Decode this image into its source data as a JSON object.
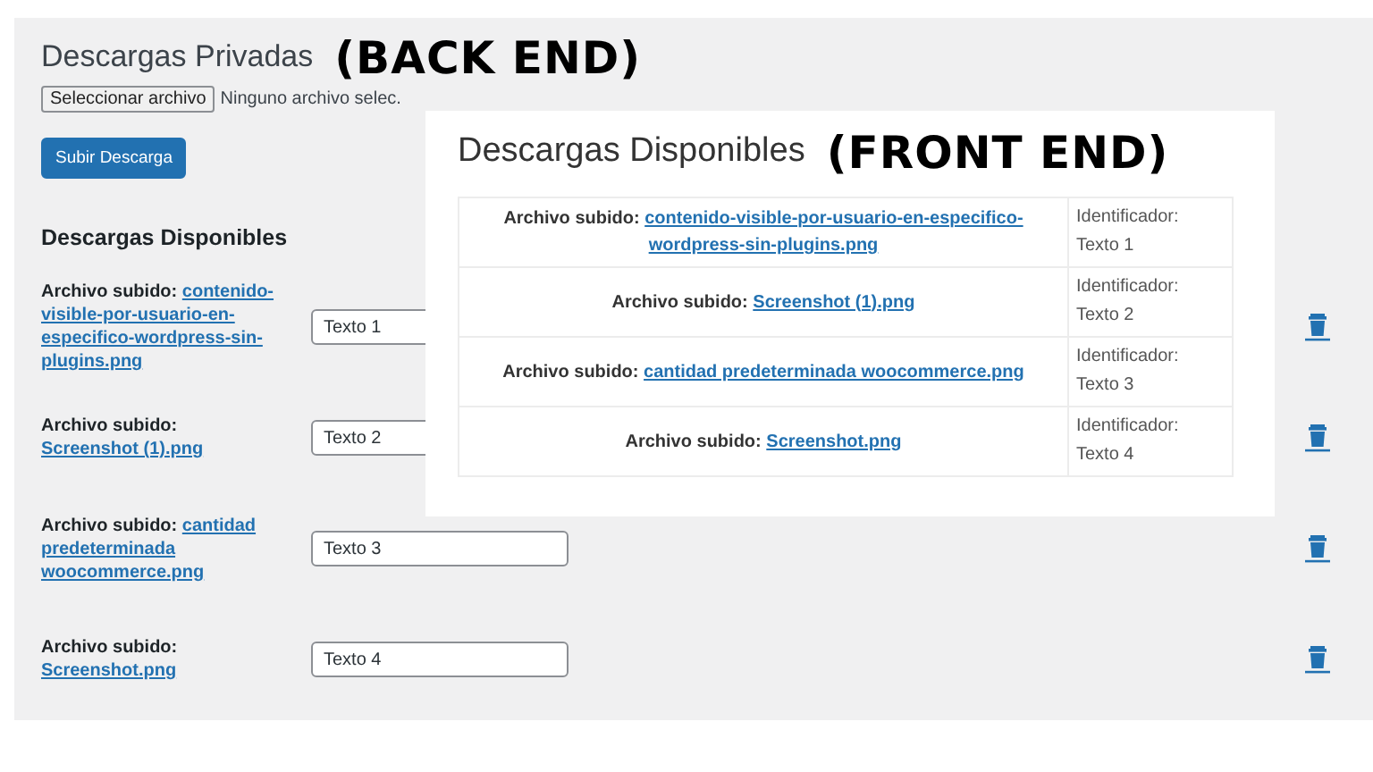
{
  "back_end": {
    "title": "Descargas Privadas",
    "annotation": "(BACK END)",
    "file_picker": {
      "button": "Seleccionar archivo",
      "status": "Ninguno archivo selec."
    },
    "upload_button": "Subir Descarga",
    "section_title": "Descargas Disponibles",
    "rows": [
      {
        "label": "Archivo subido:",
        "file": "contenido-visible-por-usuario-en-especifico-wordpress-sin-plugins.png",
        "value": "Texto 1"
      },
      {
        "label": "Archivo subido:",
        "file": "Screenshot (1).png",
        "value": "Texto 2"
      },
      {
        "label": "Archivo subido:",
        "file": "cantidad predeterminada woocommerce.png",
        "value": "Texto 3"
      },
      {
        "label": "Archivo subido:",
        "file": "Screenshot.png",
        "value": "Texto 4"
      }
    ]
  },
  "front_end": {
    "title": "Descargas Disponibles",
    "annotation": "(FRONT END)",
    "rows": [
      {
        "label": "Archivo subido:",
        "file": "contenido-visible-por-usuario-en-especifico-wordpress-sin-plugins.png",
        "id_label": "Identificador:",
        "id_value": "Texto 1"
      },
      {
        "label": "Archivo subido:",
        "file": "Screenshot (1).png",
        "id_label": "Identificador:",
        "id_value": "Texto 2"
      },
      {
        "label": "Archivo subido:",
        "file": "cantidad predeterminada woocommerce.png",
        "id_label": "Identificador:",
        "id_value": "Texto 3"
      },
      {
        "label": "Archivo subido:",
        "file": "Screenshot.png",
        "id_label": "Identificador:",
        "id_value": "Texto 4"
      }
    ]
  }
}
